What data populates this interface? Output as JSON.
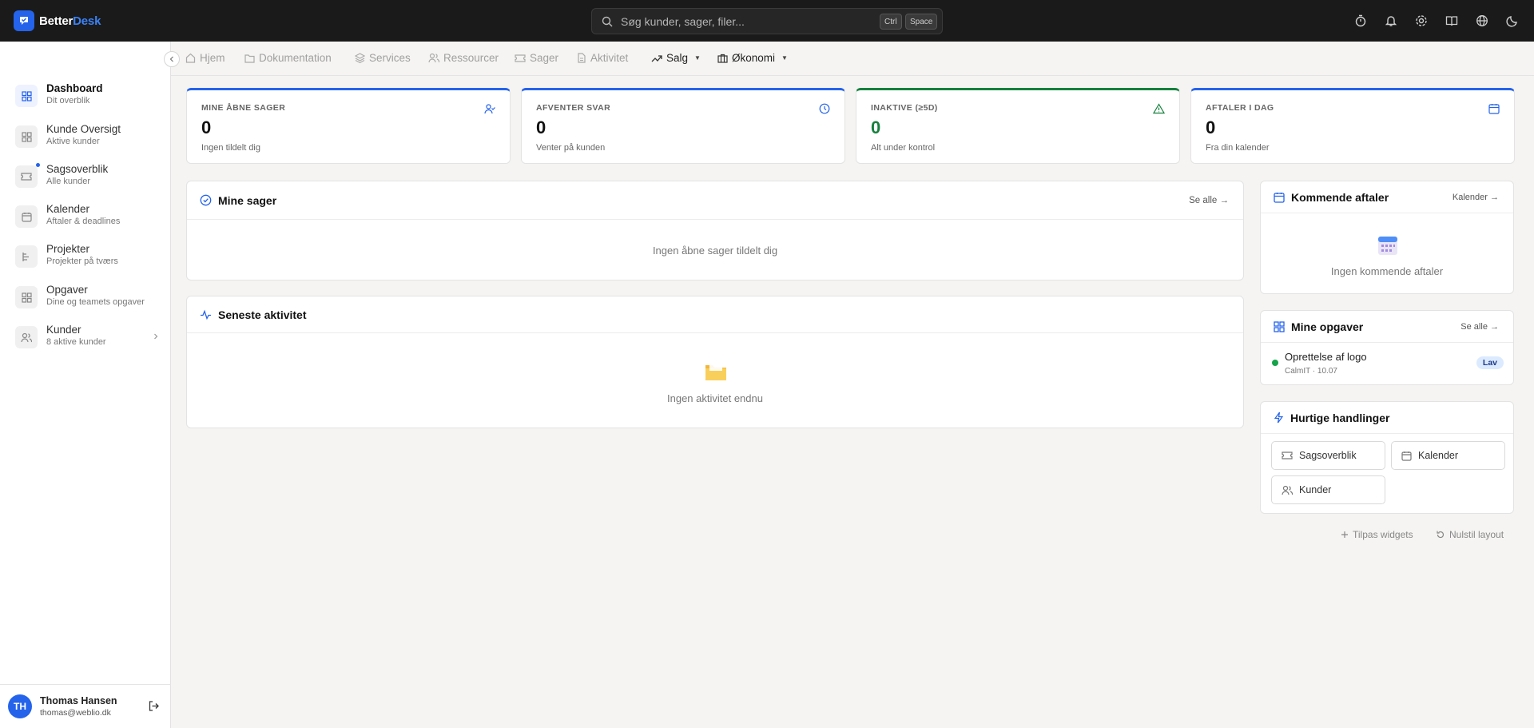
{
  "app": {
    "logo_main": "Better",
    "logo_accent": "Desk"
  },
  "search": {
    "placeholder": "Søg kunder, sager, filer...",
    "kbd_ctrl": "Ctrl",
    "kbd_space": "Space"
  },
  "top_icons": [
    "timer-icon",
    "bell-icon",
    "gear-icon",
    "book-icon",
    "globe-icon",
    "moon-icon"
  ],
  "sidebar": {
    "items": [
      {
        "title": "Dashboard",
        "sub": "Dit overblik",
        "icon": "grid-icon",
        "active": true
      },
      {
        "title": "Kunde Oversigt",
        "sub": "Aktive kunder",
        "icon": "grid-icon"
      },
      {
        "title": "Sagsoverblik",
        "sub": "Alle kunder",
        "icon": "ticket-icon"
      },
      {
        "title": "Kalender",
        "sub": "Aftaler & deadlines",
        "icon": "calendar-icon"
      },
      {
        "title": "Projekter",
        "sub": "Projekter på tværs",
        "icon": "kanban-icon"
      },
      {
        "title": "Opgaver",
        "sub": "Dine og teamets opgaver",
        "icon": "grid-icon"
      },
      {
        "title": "Kunder",
        "sub": "8 aktive kunder",
        "icon": "users-icon"
      }
    ]
  },
  "user": {
    "initials": "TH",
    "name": "Thomas Hansen",
    "email": "thomas@weblio.dk"
  },
  "nav": {
    "tabs": [
      {
        "label": "Hjem"
      },
      {
        "label": "Dokumentation"
      },
      {
        "label": "Services"
      },
      {
        "label": "Ressourcer"
      },
      {
        "label": "Sager"
      },
      {
        "label": "Aktivitet"
      },
      {
        "label": "Salg"
      },
      {
        "label": "Økonomi"
      }
    ]
  },
  "stats": [
    {
      "label": "MINE ÅBNE SAGER",
      "value": "0",
      "sub": "Ingen tildelt dig"
    },
    {
      "label": "AFVENTER SVAR",
      "value": "0",
      "sub": "Venter på kunden"
    },
    {
      "label": "INAKTIVE (≥5D)",
      "value": "0",
      "sub": "Alt under kontrol"
    },
    {
      "label": "AFTALER I DAG",
      "value": "0",
      "sub": "Fra din kalender"
    }
  ],
  "mine_sager": {
    "title": "Mine sager",
    "link": "Se alle →",
    "empty": "Ingen åbne sager tildelt dig"
  },
  "aktivitet": {
    "title": "Seneste aktivitet",
    "empty": "Ingen aktivitet endnu"
  },
  "aftaler": {
    "title": "Kommende aftaler",
    "link": "Kalender →",
    "empty": "Ingen kommende aftaler"
  },
  "opgaver": {
    "title": "Mine opgaver",
    "link": "Se alle →",
    "task_title": "Oprettelse af logo",
    "task_meta": "CalmIT · 10.07",
    "task_badge": "Lav"
  },
  "handlinger": {
    "title": "Hurtige handlinger",
    "buttons": [
      "Sagsoverblik",
      "Kalender",
      "Kunder"
    ]
  },
  "footer": {
    "tilpas": "Tilpas widgets",
    "nulstil": "Nulstil layout"
  },
  "colors": {
    "accent": "#2563eb",
    "success": "#15803d",
    "topbar": "#1a1a1a"
  }
}
